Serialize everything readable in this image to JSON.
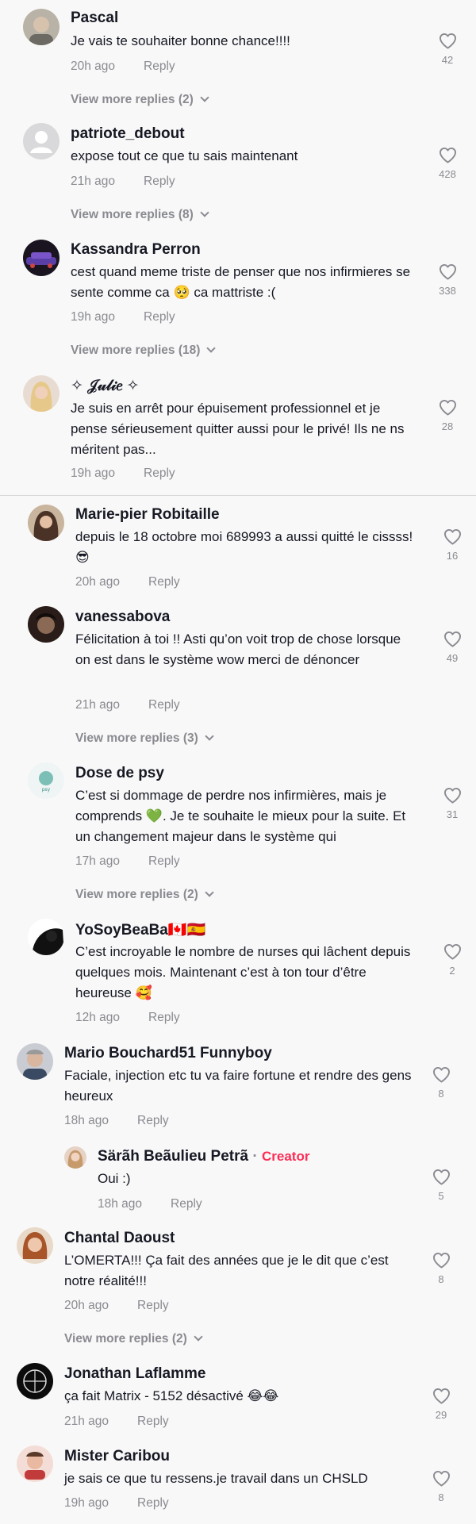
{
  "comments": [
    {
      "username": "Pascal",
      "text": "Je vais te souhaiter bonne chance!!!!",
      "time": "20h ago",
      "reply": "Reply",
      "likes": "42",
      "more": "View more replies (2)"
    },
    {
      "username": "patriote_debout",
      "text": "expose tout ce que tu sais maintenant",
      "time": "21h ago",
      "reply": "Reply",
      "likes": "428",
      "more": "View more replies (8)"
    },
    {
      "username": "Kassandra Perron",
      "text": "cest quand meme triste de penser que nos infirmieres se sente comme ca 🥺 ca mattriste :(",
      "time": "19h ago",
      "reply": "Reply",
      "likes": "338",
      "more": "View more replies (18)"
    },
    {
      "username": "✧ 𝒥𝓊𝓁𝒾𝑒 ✧",
      "text": "Je suis en arrêt pour épuisement professionnel et je pense sérieusement quitter aussi pour le privé! Ils ne ns méritent pas...",
      "time": "19h ago",
      "reply": "Reply",
      "likes": "28"
    },
    {
      "username": "Marie-pier Robitaille",
      "text": "depuis le 18 octobre moi 689993 a aussi quitté le cissss! 😎",
      "time": "20h ago",
      "reply": "Reply",
      "likes": "16"
    },
    {
      "username": "vanessabova",
      "text": "Félicitation à toi !! Asti qu’on voit trop de chose lorsque on est dans le système wow merci de dénoncer",
      "time": "21h ago",
      "reply": "Reply",
      "likes": "49",
      "more": "View more replies (3)"
    },
    {
      "username": "Dose de psy",
      "text": "C’est si dommage de perdre nos infirmières, mais je comprends 💚. Je te souhaite le mieux pour la suite. Et un changement majeur dans le système qui",
      "time": "17h ago",
      "reply": "Reply",
      "likes": "31",
      "more": "View more replies (2)"
    },
    {
      "username": "YoSoyBeaBa🇨🇦🇪🇸",
      "text": "C’est incroyable le nombre de nurses qui lâchent depuis quelques mois. Maintenant c’est à ton tour d’être heureuse 🥰",
      "time": "12h ago",
      "reply": "Reply",
      "likes": "2"
    },
    {
      "username": "Mario Bouchard51 Funnyboy",
      "text": "Faciale, injection etc tu va faire fortune et rendre des gens heureux",
      "time": "18h ago",
      "reply": "Reply",
      "likes": "8"
    },
    {
      "username": "Särãh Beãulieu Petrã",
      "creator": "Creator",
      "dot": "·",
      "text": "Oui :)",
      "time": "18h ago",
      "reply": "Reply",
      "likes": "5"
    },
    {
      "username": "Chantal Daoust",
      "text": "L’OMERTA!!! Ça fait des années que je le dit que c’est notre réalité!!!",
      "time": "20h ago",
      "reply": "Reply",
      "likes": "8",
      "more": "View more replies (2)"
    },
    {
      "username": "Jonathan Laflamme",
      "text": "ça fait Matrix - 5152 désactivé 😂😂",
      "time": "21h ago",
      "reply": "Reply",
      "likes": "29"
    },
    {
      "username": "Mister Caribou",
      "text": "je sais ce que tu ressens.je travail dans un CHSLD",
      "time": "19h ago",
      "reply": "Reply",
      "likes": "8"
    }
  ],
  "colors": {
    "accent": "#fe2c55",
    "meta": "#8a8b91",
    "text": "#161823"
  },
  "icons": {
    "like": "heart-outline-icon",
    "expand": "chevron-down-icon"
  }
}
